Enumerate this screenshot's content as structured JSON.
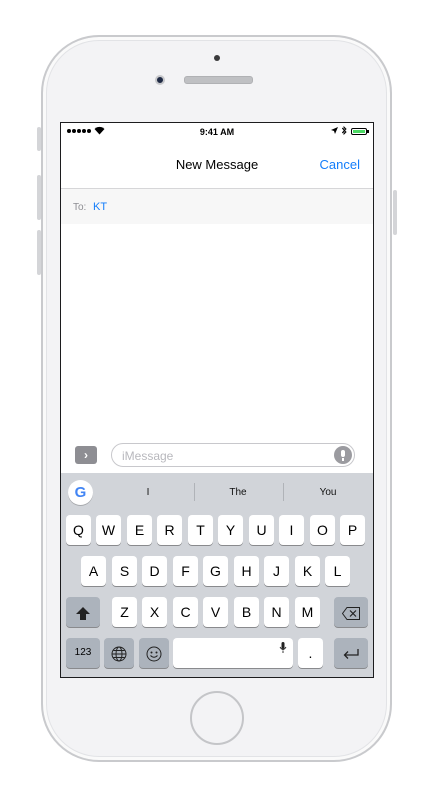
{
  "status_bar": {
    "time": "9:41 AM",
    "signal_dots": 5
  },
  "navbar": {
    "title": "New Message",
    "cancel_label": "Cancel"
  },
  "recipient": {
    "label": "To:",
    "value": "KT"
  },
  "compose": {
    "placeholder": "iMessage",
    "apps_button_icon": "chevron-right-icon",
    "mic_icon": "microphone-icon"
  },
  "keyboard": {
    "suggestion_provider_icon": "google-g-icon",
    "suggestion_logo_letter": "G",
    "suggestions": [
      "I",
      "The",
      "You"
    ],
    "row1": [
      "Q",
      "W",
      "E",
      "R",
      "T",
      "Y",
      "U",
      "I",
      "O",
      "P"
    ],
    "row2": [
      "A",
      "S",
      "D",
      "F",
      "G",
      "H",
      "J",
      "K",
      "L"
    ],
    "row3": [
      "Z",
      "X",
      "C",
      "V",
      "B",
      "N",
      "M"
    ],
    "shift_icon": "shift-arrow-icon",
    "backspace_icon": "backspace-icon",
    "numbers_label": "123",
    "globe_icon": "globe-icon",
    "emoji_icon": "emoji-icon",
    "space_mic_icon": "microphone-icon",
    "period_label": ".",
    "return_icon": "return-arrow-icon"
  },
  "colors": {
    "accent": "#147efb",
    "keyboard_bg": "#d1d4d9",
    "special_key": "#acb3bc"
  }
}
